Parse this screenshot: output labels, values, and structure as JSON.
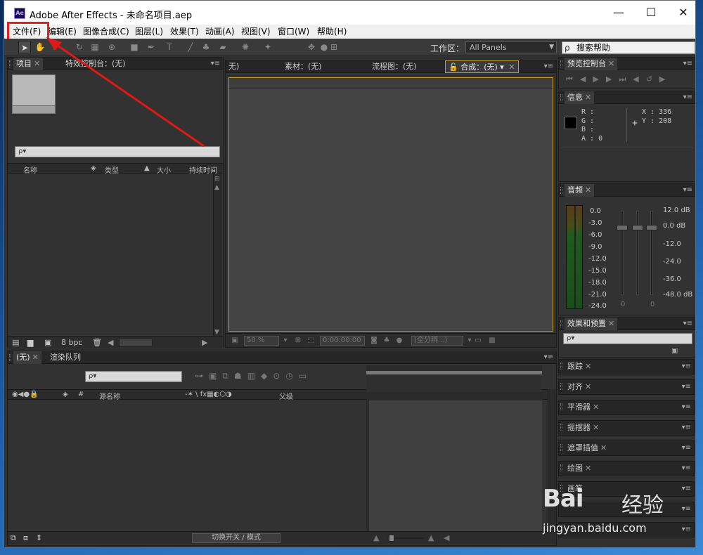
{
  "window": {
    "app_icon": "Ae",
    "title": "Adobe After Effects - 未命名项目.aep",
    "minimize": "—",
    "maximize": "☐",
    "close": "✕"
  },
  "menu": {
    "items": [
      "文件(F)",
      "编辑(E)",
      "图像合成(C)",
      "图层(L)",
      "效果(T)",
      "动画(A)",
      "视图(V)",
      "窗口(W)",
      "帮助(H)"
    ],
    "highlight_color": "#e02020"
  },
  "toolbar": {
    "workspace_label": "工作区：",
    "workspace_value": "All Panels",
    "help_search_placeholder": "搜索帮助"
  },
  "project_panel": {
    "tab_project": "项目",
    "tab_effect_controls": "特效控制台：(无)",
    "search_placeholder": "ρ▾",
    "columns": [
      "名称",
      "类型",
      "大小",
      "持续时间"
    ],
    "bit_depth": "8 bpc"
  },
  "comp_panel": {
    "tab_partial": "无)",
    "tab_footage": "素材：(无)",
    "tab_flowchart": "流程图：(无)",
    "tab_comp": "合成：(无)",
    "zoom": "50 %",
    "timecode": "0:00:00:00",
    "resolution": "(全分辨...)"
  },
  "preview_panel": {
    "tab": "预览控制台"
  },
  "info_panel": {
    "tab": "信息",
    "r": "R :",
    "g": "G :",
    "b": "B :",
    "a": "A : 0",
    "x": "X : 336",
    "y": "Y : 208"
  },
  "audio_panel": {
    "tab": "音频",
    "left_scale": [
      "0.0",
      "-3.0",
      "-6.0",
      "-9.0",
      "-12.0",
      "-15.0",
      "-18.0",
      "-21.0",
      "-24.0"
    ],
    "right_scale": [
      "12.0 dB",
      "0.0 dB",
      "-12.0",
      "-24.0",
      "-36.0",
      "-48.0 dB"
    ],
    "slider_zero_left": "0",
    "slider_zero_right": "0"
  },
  "effects_panel": {
    "tab": "效果和预置",
    "search_placeholder": "ρ▾"
  },
  "side_panels": [
    "跟踪",
    "对齐",
    "平滑器",
    "摇摆器",
    "遮罩插值",
    "绘图",
    "画笔"
  ],
  "timeline": {
    "tab_none": "(无)",
    "tab_render": "渲染队列",
    "search_placeholder": "ρ▾",
    "col_source": "源名称",
    "col_parent": "父级",
    "col_hash": "#",
    "toggle_label": "切换开关 / 模式"
  },
  "watermark": {
    "logo": "Bai",
    "cn": "经验",
    "url": "jingyan.baidu.com"
  }
}
